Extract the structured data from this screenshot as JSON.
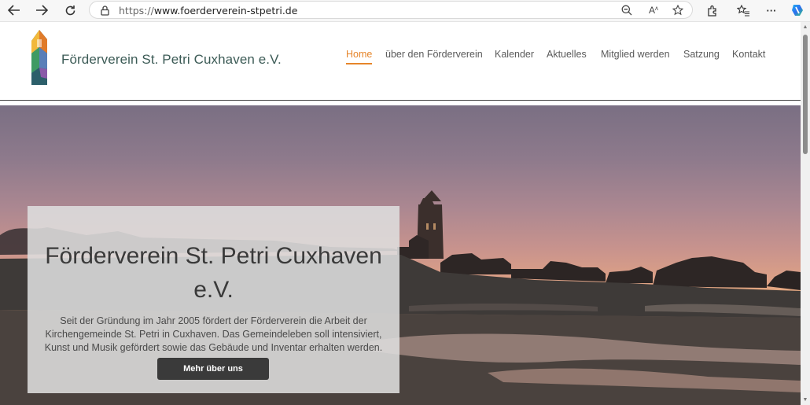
{
  "browser": {
    "url_protocol": "https://",
    "url_domain": "www.foerderverein-stpetri.de",
    "icons": {
      "back": "arrow-left-icon",
      "forward": "arrow-right-icon",
      "reload": "reload-icon",
      "lock": "lock-icon",
      "zoom": "zoom-out-icon",
      "read_aloud": "read-aloud-icon",
      "favorite": "star-icon",
      "extensions": "puzzle-icon",
      "favorites": "favorites-icon",
      "more": "more-icon",
      "copilot": "copilot-icon"
    },
    "read_aloud_glyph": "A",
    "more_glyph": "···"
  },
  "site": {
    "title": "Förderverein St. Petri Cuxhaven e.V.",
    "menu": [
      {
        "label": "Home",
        "active": true
      },
      {
        "label": "über den Förderverein",
        "active": false
      },
      {
        "label": "Kalender",
        "active": false
      },
      {
        "label": "Aktuelles",
        "active": false
      },
      {
        "label": "Mitglied werden",
        "active": false
      },
      {
        "label": "Satzung",
        "active": false
      },
      {
        "label": "Kontakt",
        "active": false
      }
    ],
    "accent_color": "#e6852a",
    "title_color": "#3c5b56"
  },
  "hero": {
    "heading": "Förderverein St. Petri Cuxhaven e.V.",
    "text": "Seit der Gründung im Jahr 2005 fördert der Förderverein die Arbeit der Kirchengemeinde St. Petri in Cuxhaven. Das Gemeindeleben soll intensiviert, Kunst und Musik gefördert sowie das Gebäude und Inventar erhalten werden.",
    "button_label": "Mehr über uns"
  }
}
